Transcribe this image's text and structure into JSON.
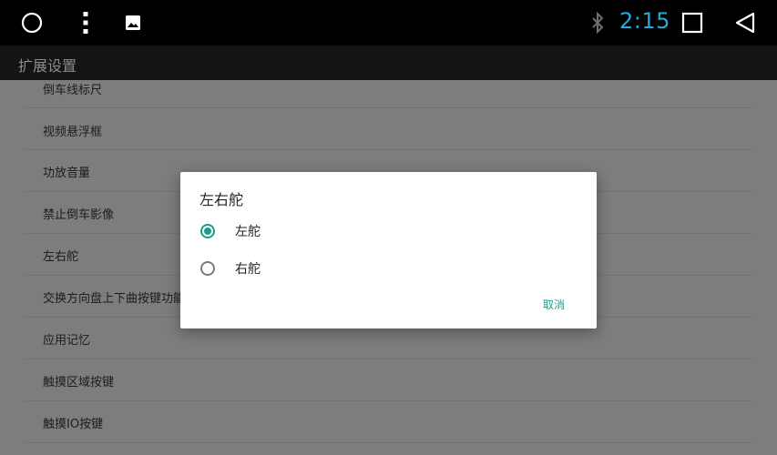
{
  "status_bar": {
    "left_icons": [
      "circle-home-icon",
      "more-vert-icon",
      "image-icon"
    ],
    "right_icons": [
      "bluetooth-icon",
      "recent-apps-square-icon",
      "back-triangle-icon"
    ],
    "time": "2:15",
    "time_color": "#27a9d9"
  },
  "action_bar": {
    "title": "扩展设置"
  },
  "settings_list": {
    "items": [
      "倒车线标尺",
      "视频悬浮框",
      "功放音量",
      "禁止倒车影像",
      "左右舵",
      "交换方向盘上下曲按键功能",
      "应用记忆",
      "触摸区域按键",
      "触摸IO按键"
    ]
  },
  "dialog": {
    "title": "左右舵",
    "options": [
      {
        "label": "左舵",
        "checked": true
      },
      {
        "label": "右舵",
        "checked": false
      }
    ],
    "cancel_label": "取消",
    "accent_color": "#1a9c8c"
  }
}
